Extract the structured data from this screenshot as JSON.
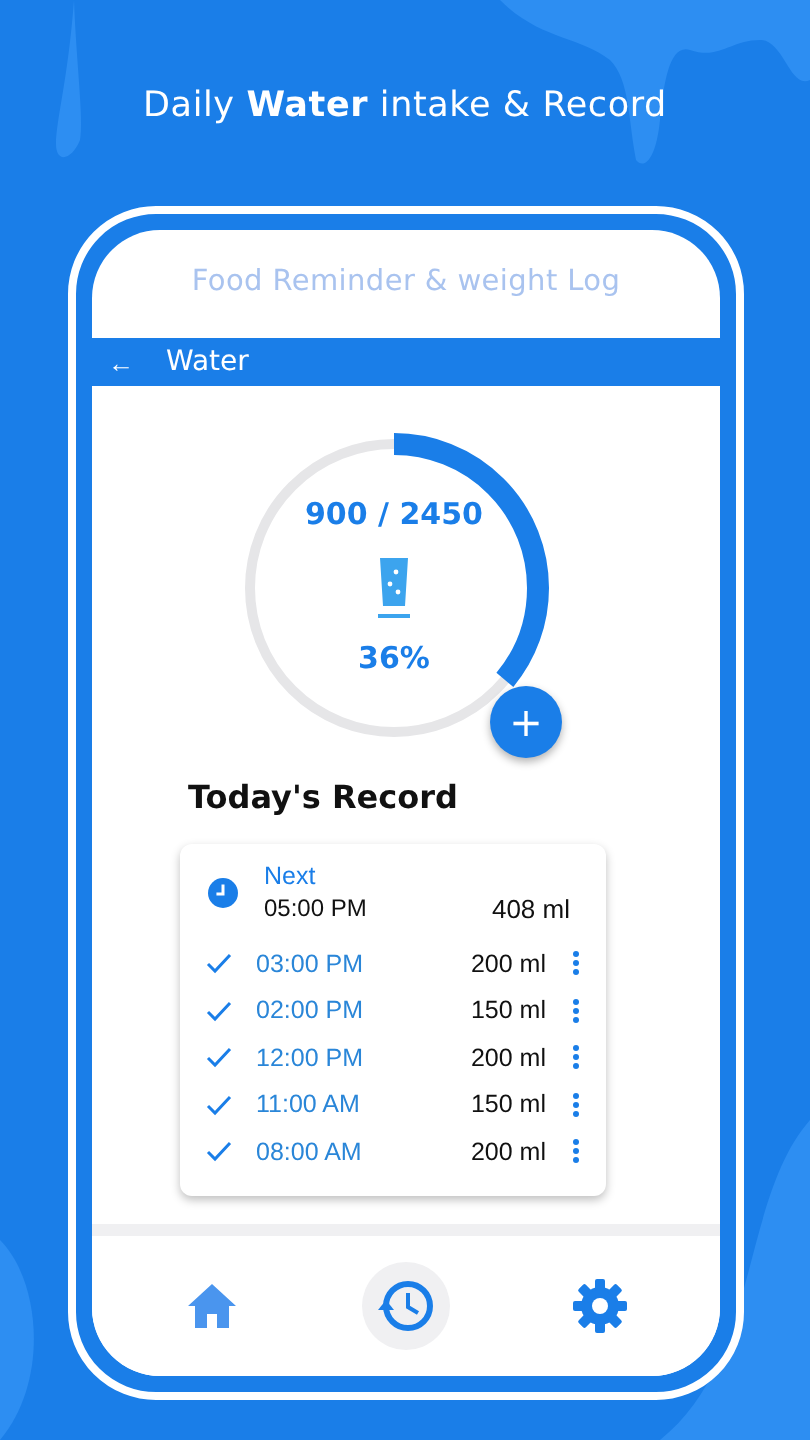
{
  "headline": "Daily **Water** intake & Record",
  "app_title": "Food Reminder & weight Log",
  "app_bar": {
    "back": "←",
    "title": "Water"
  },
  "progress": {
    "amount": "900 / 2450",
    "percent": "36%",
    "level": 0.36,
    "add": "+"
  },
  "section_title": "Today's Record",
  "next": {
    "label": "Next",
    "time": "05:00 PM",
    "amount": "408 ml"
  },
  "records": [
    {
      "time": "03:00 PM",
      "amount": "200 ml",
      "done": true
    },
    {
      "time": "02:00 PM",
      "amount": "150 ml",
      "done": true
    },
    {
      "time": "12:00 PM",
      "amount": "200 ml",
      "done": true
    },
    {
      "time": "11:00 AM",
      "amount": "150 ml",
      "done": true
    },
    {
      "time": "08:00 AM",
      "amount": "200 ml",
      "done": true
    }
  ],
  "nav": [
    {
      "kind": "home",
      "selected": false
    },
    {
      "kind": "history",
      "selected": true
    },
    {
      "kind": "settings",
      "selected": false
    }
  ]
}
